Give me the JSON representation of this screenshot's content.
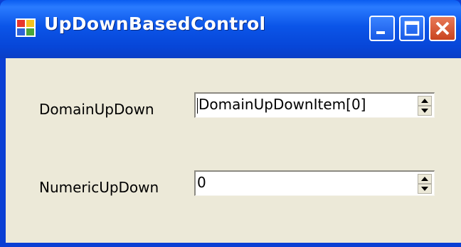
{
  "window": {
    "title": "UpDownBasedControl",
    "colors": {
      "titlebar": "#0a55e8",
      "client": "#ece9d8",
      "close_button": "#d45a34"
    }
  },
  "titlebar_buttons": {
    "minimize_icon": "minimize-icon",
    "maximize_icon": "maximize-icon",
    "close_icon": "close-icon"
  },
  "form": {
    "domain_label": "DomainUpDown",
    "domain_value": "DomainUpDownItem[0]",
    "numeric_label": "NumericUpDown",
    "numeric_value": "0"
  }
}
